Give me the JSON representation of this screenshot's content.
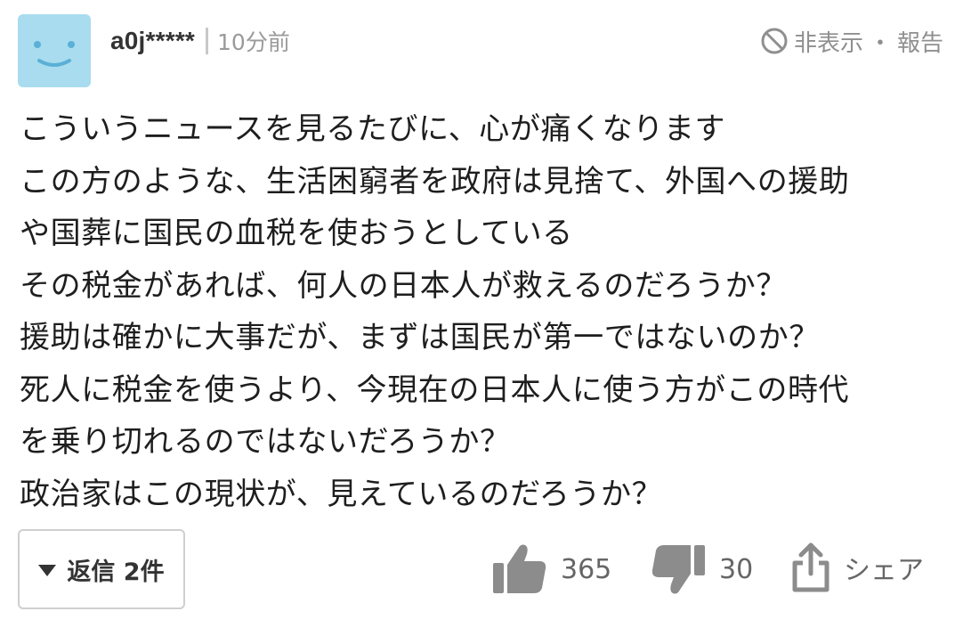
{
  "avatar": {
    "color": "#a9dcef",
    "icon": "smiley-face"
  },
  "header": {
    "username": "a0j*****",
    "timestamp": "10分前",
    "hide_label": "非表示",
    "separator": "・",
    "report_label": "報告"
  },
  "comment": {
    "lines": [
      "こういうニュースを見るたびに、心が痛くなります",
      "この方のような、生活困窮者を政府は見捨て、外国への援助",
      "や国葬に国民の血税を使おうとしている",
      "その税金があれば、何人の日本人が救えるのだろうか？",
      "援助は確かに大事だが、まずは国民が第一ではないのか？",
      "死人に税金を使うより、今現在の日本人に使う方がこの時代",
      "を乗り切れるのではないだろうか？",
      "政治家はこの現状が、見えているのだろうか？"
    ]
  },
  "footer": {
    "reply_label": "返信 2件",
    "like_count": "365",
    "dislike_count": "30",
    "share_label": "シェア"
  }
}
